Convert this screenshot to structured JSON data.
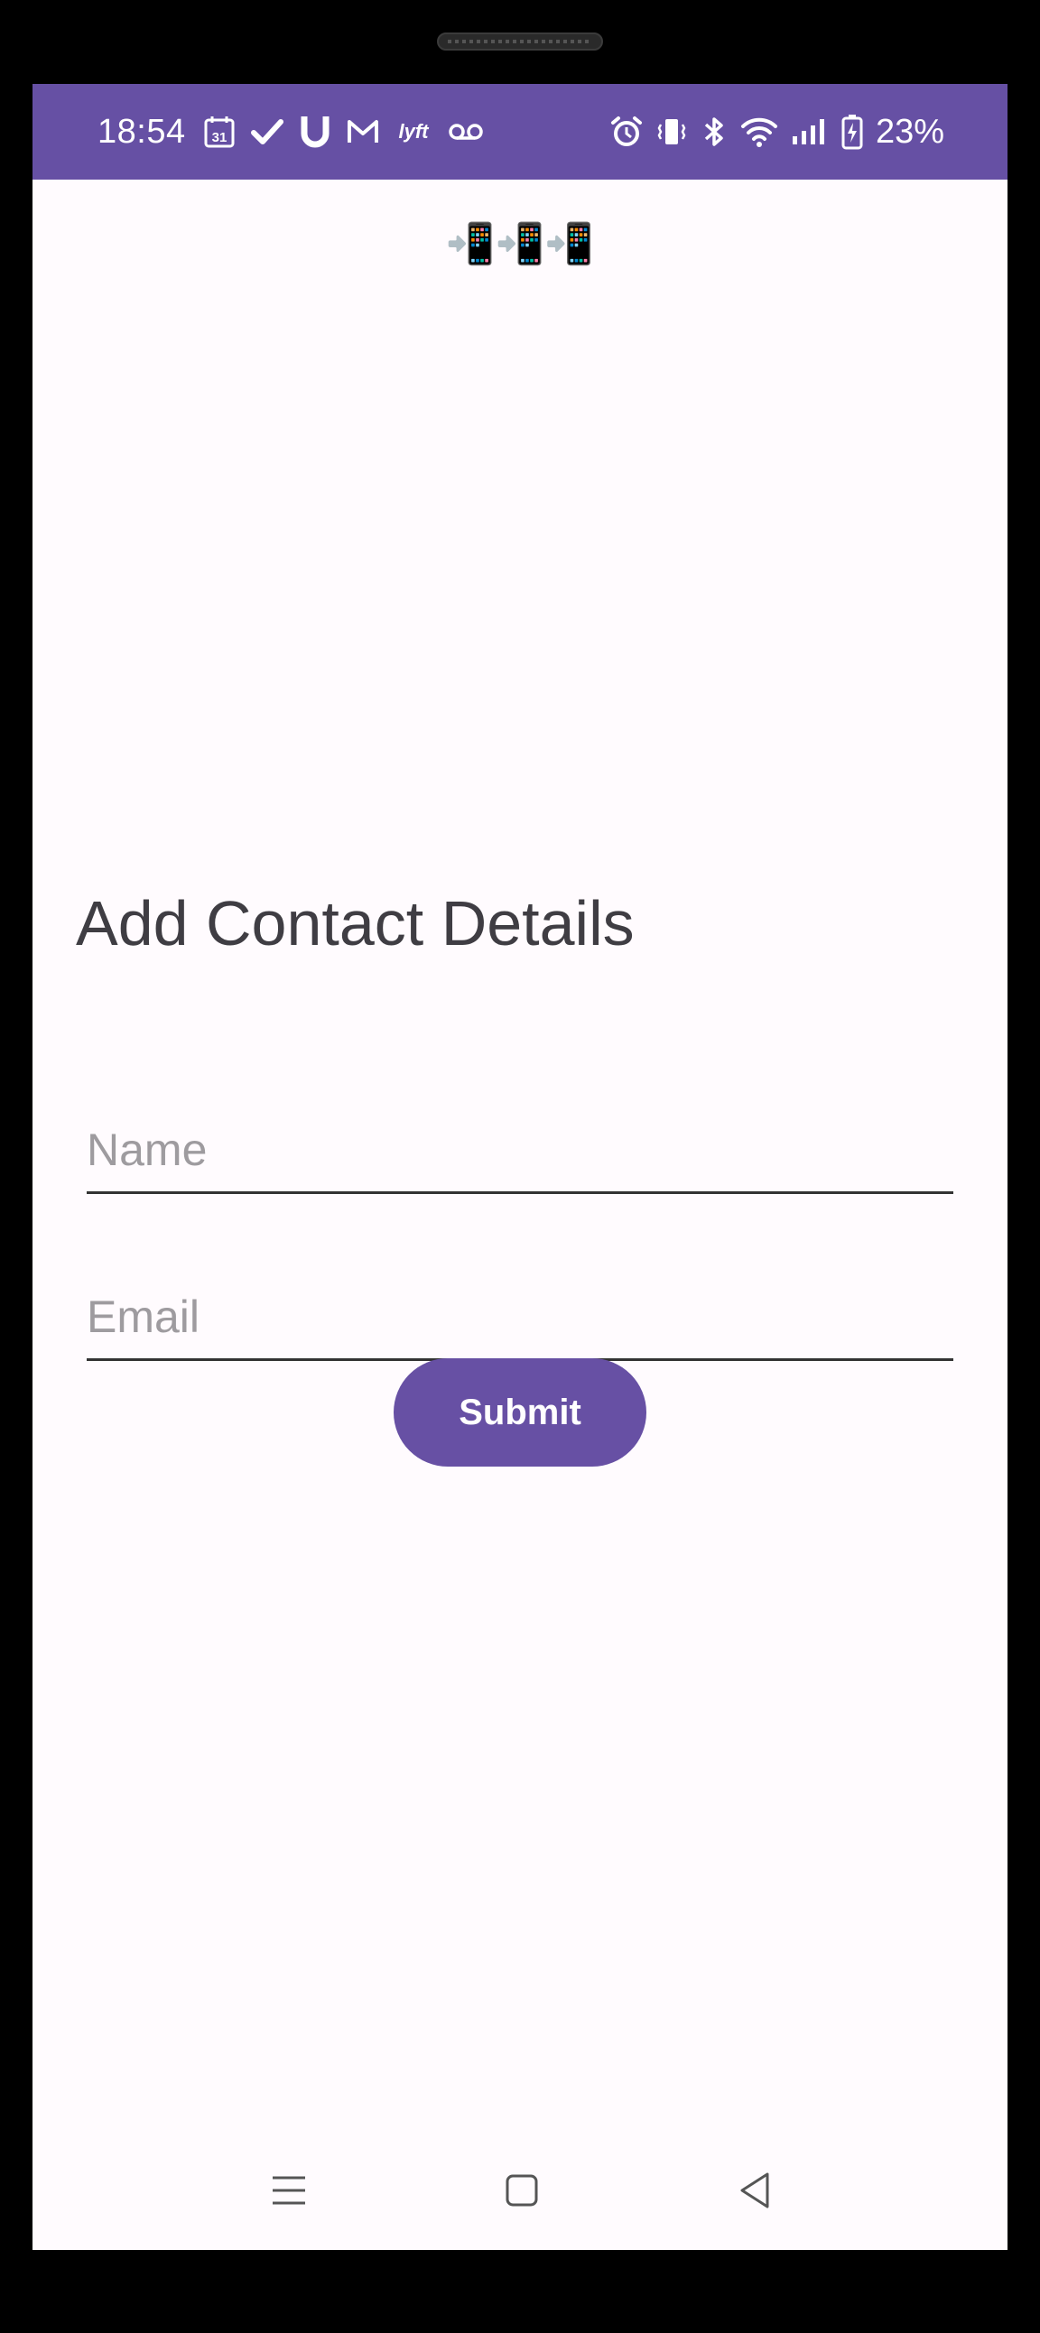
{
  "status_bar": {
    "time": "18:54",
    "calendar_day": "31",
    "battery": "23%",
    "background": "#6650a4",
    "notification_icons": [
      "calendar-icon",
      "checkmark-icon",
      "u-app-icon",
      "gmail-icon",
      "lyft-icon",
      "voicemail-icon"
    ],
    "system_icons": [
      "alarm-icon",
      "vibrate-icon",
      "bluetooth-icon",
      "wifi-icon",
      "signal-icon",
      "battery-charging-icon"
    ]
  },
  "header": {
    "emoji": "📲📲📲"
  },
  "form": {
    "title": "Add Contact Details",
    "name_placeholder": "Name",
    "name_value": "",
    "email_placeholder": "Email",
    "email_value": "",
    "submit_label": "Submit",
    "accent": "#6750a4"
  },
  "nav_bar": {
    "buttons": [
      "recents-icon",
      "home-icon",
      "back-icon"
    ]
  }
}
